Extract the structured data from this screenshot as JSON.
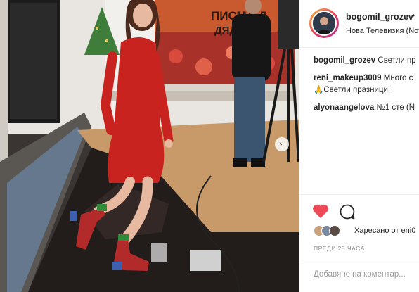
{
  "post": {
    "photo": {
      "sign_line1": "ПИСМА Д",
      "sign_line2": "ДЯДО К"
    },
    "header": {
      "username": "bogomil_grozev",
      "separator": "•",
      "location": "Нова Телевизия (Nov"
    },
    "comments": [
      {
        "user": "bogomil_grozev",
        "text": "Светли пр"
      },
      {
        "user": "reni_makeup3009",
        "text": "Много с"
      },
      {
        "user": "",
        "text": "🙏Светли празници!"
      },
      {
        "user": "alyonaangelova",
        "text": "№1 сте (N"
      }
    ],
    "likes": {
      "text": "Харесано от eni0"
    },
    "time": "ПРЕДИ 23 ЧАСА",
    "add_comment_placeholder": "Добавяне на коментар..."
  }
}
